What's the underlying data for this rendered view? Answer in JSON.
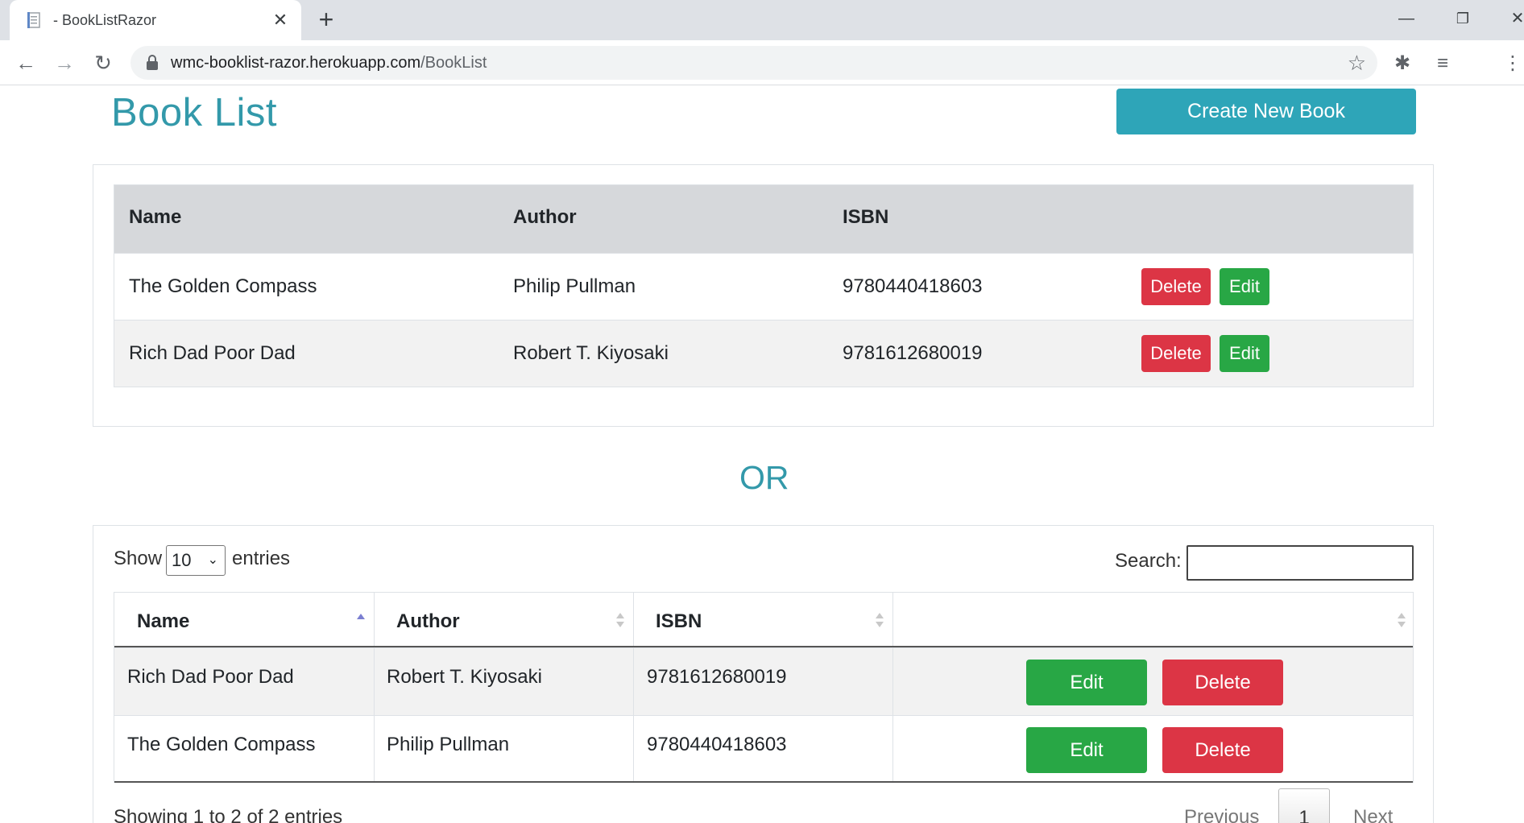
{
  "browser": {
    "tab_title": "- BookListRazor",
    "url_host": "wmc-booklist-razor.herokuapp.com",
    "url_path": "/BookList"
  },
  "page": {
    "title": "Book List",
    "create_button": "Create New Book",
    "separator": "OR"
  },
  "table1": {
    "headers": [
      "Name",
      "Author",
      "ISBN"
    ],
    "rows": [
      {
        "name": "The Golden Compass",
        "author": "Philip Pullman",
        "isbn": "9780440418603"
      },
      {
        "name": "Rich Dad Poor Dad",
        "author": "Robert T. Kiyosaki",
        "isbn": "9781612680019"
      }
    ],
    "delete_label": "Delete",
    "edit_label": "Edit"
  },
  "datatable": {
    "show_label": "Show",
    "page_length": "10",
    "entries_label": "entries",
    "search_label": "Search:",
    "headers": [
      "Name",
      "Author",
      "ISBN"
    ],
    "rows": [
      {
        "name": "Rich Dad Poor Dad",
        "author": "Robert T. Kiyosaki",
        "isbn": "9781612680019"
      },
      {
        "name": "The Golden Compass",
        "author": "Philip Pullman",
        "isbn": "9780440418603"
      }
    ],
    "edit_label": "Edit",
    "delete_label": "Delete",
    "info": "Showing 1 to 2 of 2 entries",
    "previous": "Previous",
    "current_page": "1",
    "next": "Next"
  },
  "colors": {
    "accent": "#3399aa",
    "danger": "#dc3545",
    "success": "#28a745"
  }
}
